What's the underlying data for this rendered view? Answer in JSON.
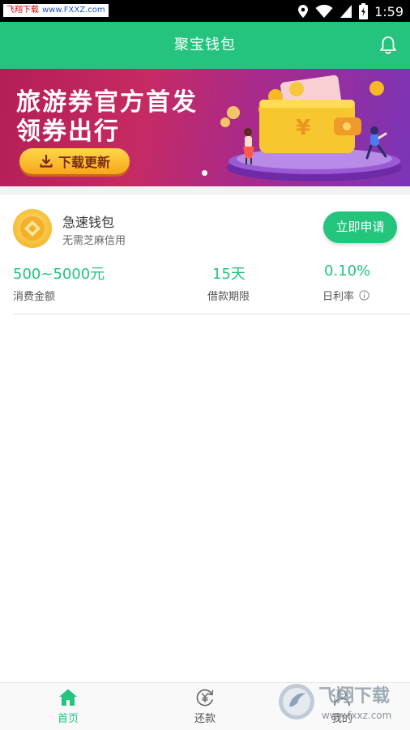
{
  "status_bar": {
    "watermark_label": "飞翔下载",
    "watermark_url": "www.FXXZ.com",
    "time": "1:59"
  },
  "app_bar": {
    "title": "聚宝钱包",
    "action_icon": "bell-icon"
  },
  "banner": {
    "line1": "旅游券官方首发",
    "line2": "领券出行",
    "button_label": "下载更新",
    "button_icon": "download-icon",
    "currency_symbol": "¥"
  },
  "product": {
    "name": "急速钱包",
    "subtitle": "无需芝麻信用",
    "apply_label": "立即申请",
    "stats": [
      {
        "value": "500~5000元",
        "label": "消费金额"
      },
      {
        "value": "15天",
        "label": "借款期限"
      },
      {
        "value": "0.10%",
        "label": "日利率",
        "info_icon": "info-icon"
      }
    ]
  },
  "bottom_nav": {
    "items": [
      {
        "label": "首页",
        "icon": "home-icon",
        "active": true
      },
      {
        "label": "还款",
        "icon": "repay-icon",
        "active": false
      },
      {
        "label": "我的",
        "icon": "user-icon",
        "active": false
      }
    ]
  },
  "watermark": {
    "brand": "飞翔下载",
    "url": "www.fxxz.com"
  },
  "colors": {
    "primary": "#24c47e",
    "banner_pink": "#c62a63",
    "banner_purple": "#7b35b8",
    "button_yellow": "#f7a51b",
    "nav_inactive": "#555555"
  }
}
